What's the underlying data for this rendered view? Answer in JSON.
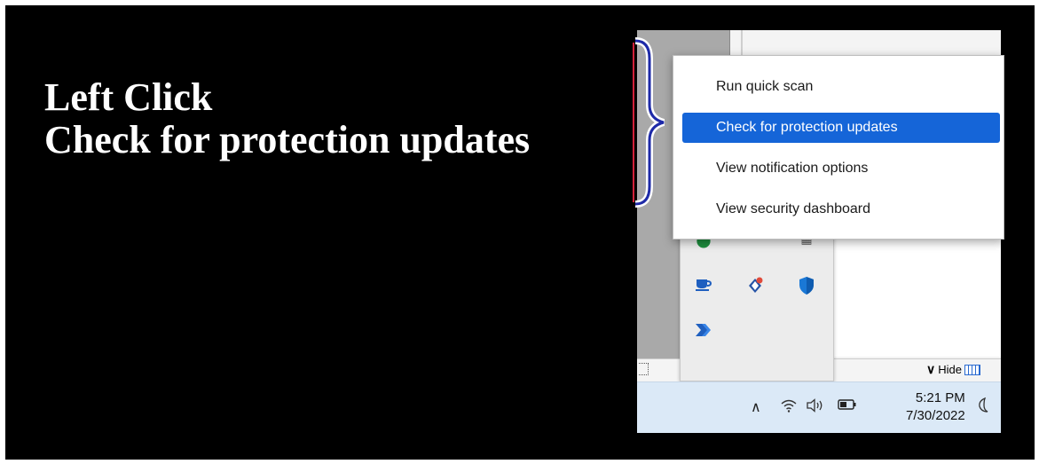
{
  "caption": {
    "line1": "Left Click",
    "line2": "Check for protection updates"
  },
  "context_menu": {
    "items": [
      {
        "label": "Run quick scan",
        "selected": false
      },
      {
        "label": "Check for protection updates",
        "selected": true
      },
      {
        "label": "View notification options",
        "selected": false
      },
      {
        "label": "View security dashboard",
        "selected": false
      }
    ]
  },
  "tray": {
    "hide_label": "Hide",
    "icons": [
      "green-check-shield-icon",
      "minus-icon",
      "grid-icon",
      "coffee-cup-icon",
      "sync-app-icon",
      "windows-security-shield-icon",
      "automate-arrow-icon"
    ]
  },
  "taskbar": {
    "time": "5:21 PM",
    "date": "7/30/2022",
    "system_icons": [
      "chevron-up-icon",
      "wifi-icon",
      "speaker-icon",
      "battery-icon",
      "moon-icon"
    ]
  },
  "colors": {
    "selection": "#1565d8",
    "taskbar": "#dbe9f7",
    "brace_outline": "#1e2aa8",
    "brace_accent": "#d2223a"
  }
}
